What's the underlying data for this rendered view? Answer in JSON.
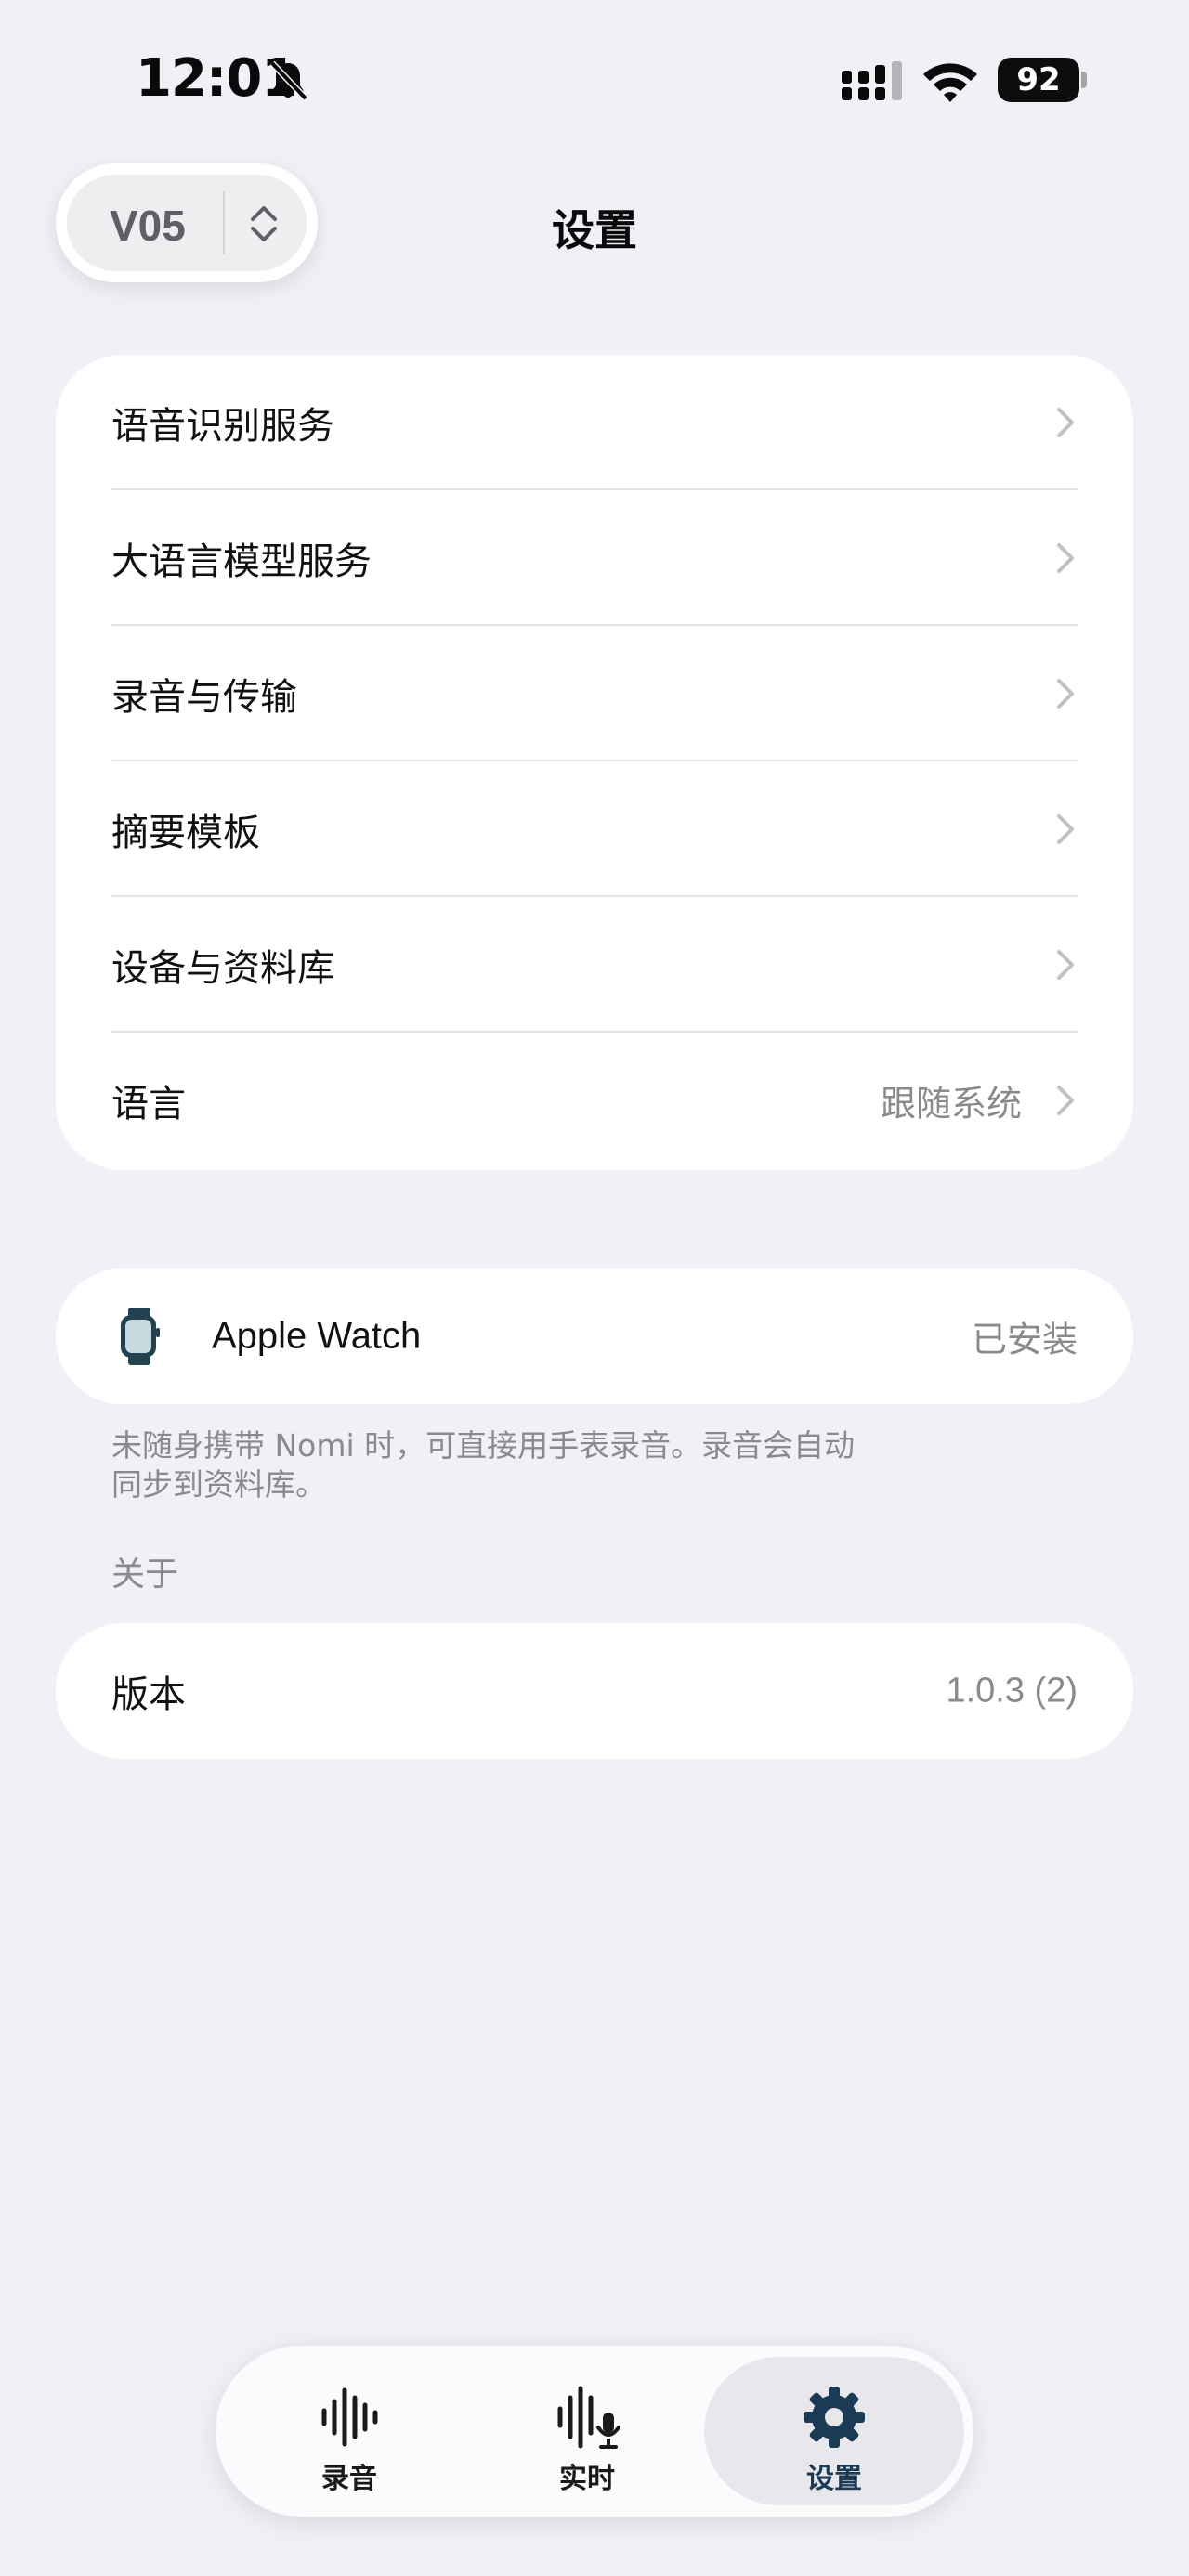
{
  "status_bar": {
    "time": "12:01",
    "battery": "92"
  },
  "header": {
    "version_selector": "V05",
    "title": "设置"
  },
  "settings_list": {
    "items": [
      {
        "label": "语音识别服务",
        "value": ""
      },
      {
        "label": "大语言模型服务",
        "value": ""
      },
      {
        "label": "录音与传输",
        "value": ""
      },
      {
        "label": "摘要模板",
        "value": ""
      },
      {
        "label": "设备与资料库",
        "value": ""
      },
      {
        "label": "语言",
        "value": "跟随系统"
      }
    ]
  },
  "watch": {
    "label": "Apple Watch",
    "status": "已安装",
    "footnote_line1": "未随身携带 Nomi 时，可直接用手表录音。录音会自动",
    "footnote_line2": "同步到资料库。"
  },
  "about": {
    "section_title": "关于",
    "version_label": "版本",
    "version_value": "1.0.3 (2)"
  },
  "tab_bar": {
    "tabs": [
      {
        "label": "录音",
        "icon": "waveform-icon",
        "active": false
      },
      {
        "label": "实时",
        "icon": "waveform-mic-icon",
        "active": false
      },
      {
        "label": "设置",
        "icon": "gear-icon",
        "active": true
      }
    ]
  },
  "colors": {
    "background": "#f1f0f6",
    "card": "#ffffff",
    "secondary_text": "#8a8a8e",
    "active_tab_icon": "#1a3a55"
  }
}
